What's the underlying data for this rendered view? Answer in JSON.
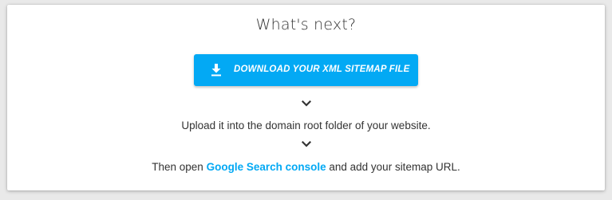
{
  "heading": "What's next?",
  "download_button": {
    "label": "DOWNLOAD YOUR XML SITEMAP FILE",
    "icon": "download-icon",
    "color": "#03a9f4"
  },
  "steps": {
    "upload_text": "Upload it into the domain root folder of your website.",
    "open_prefix": "Then open ",
    "console_link": "Google Search console",
    "open_suffix": " and add your sitemap URL."
  },
  "icons": {
    "arrow": "chevron-down-icon"
  },
  "colors": {
    "accent": "#03a9f4",
    "text": "#333333",
    "background": "#e9e9e9",
    "card": "#ffffff"
  }
}
